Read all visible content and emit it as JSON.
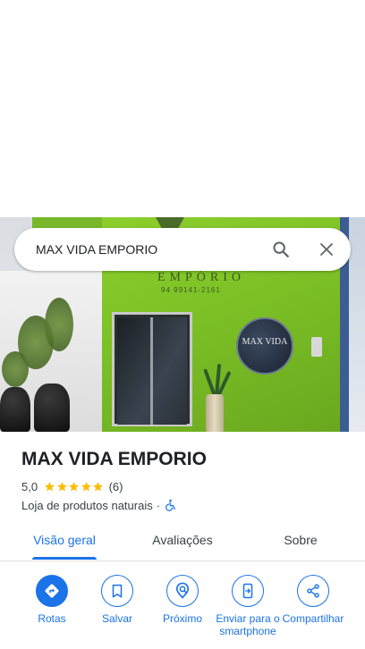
{
  "search": {
    "query": "MAX VIDA EMPORIO",
    "search_icon": "search-icon",
    "close_icon": "close-icon"
  },
  "photo": {
    "sign_text": "EMPÓRIO",
    "phone_text": "94 99141-2161",
    "window_text": "MAX VIDA"
  },
  "place": {
    "name": "MAX VIDA EMPORIO",
    "rating": "5,0",
    "rating_value": 5,
    "stars_max": 5,
    "review_count": "(6)",
    "category": "Loja de produtos naturais",
    "separator": "·",
    "accessibility_icon": "wheelchair-icon"
  },
  "tabs": [
    {
      "label": "Visão geral",
      "active": true
    },
    {
      "label": "Avaliações",
      "active": false
    },
    {
      "label": "Sobre",
      "active": false
    }
  ],
  "actions": [
    {
      "label": "Rotas",
      "icon": "directions-icon"
    },
    {
      "label": "Salvar",
      "icon": "bookmark-icon"
    },
    {
      "label": "Próximo",
      "icon": "nearby-icon"
    },
    {
      "label": "Enviar para o smartphone",
      "icon": "send-to-phone-icon"
    },
    {
      "label": "Compartilhar",
      "icon": "share-icon"
    }
  ],
  "colors": {
    "accent": "#1a73e8",
    "star": "#fbbc04",
    "storefront_green": "#7cc026"
  }
}
